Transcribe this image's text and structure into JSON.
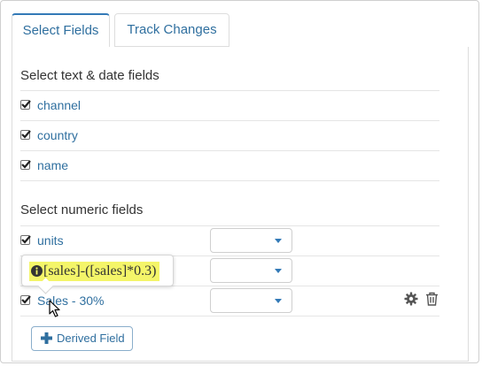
{
  "tabs": {
    "select_fields": "Select Fields",
    "track_changes": "Track Changes"
  },
  "text_date": {
    "heading": "Select text & date fields",
    "fields": [
      "channel",
      "country",
      "name"
    ]
  },
  "numeric": {
    "heading": "Select numeric fields",
    "fields": [
      "units",
      "",
      "Sales - 30%"
    ]
  },
  "tooltip": {
    "formula": "[sales]-([sales]*0.3)"
  },
  "buttons": {
    "derived_field": "Derived Field"
  },
  "colors": {
    "link": "#2f6f9f",
    "accent": "#337ab7",
    "highlight": "#f4f569"
  },
  "icons": [
    "info-icon",
    "gear-icon",
    "trash-icon",
    "plus-icon",
    "caret-down-icon",
    "mouse-cursor-icon"
  ]
}
